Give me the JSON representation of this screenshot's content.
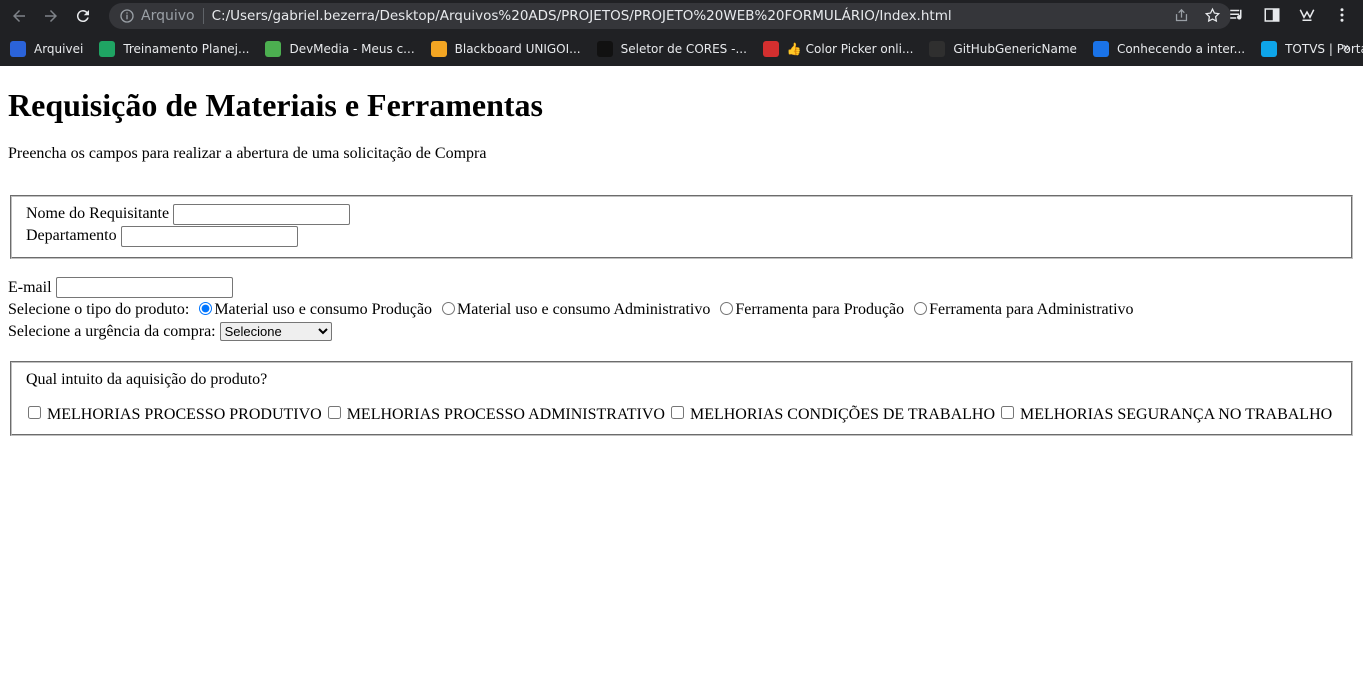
{
  "browser": {
    "address_label": "Arquivo",
    "url": "C:/Users/gabriel.bezerra/Desktop/Arquivos%20ADS/PROJETOS/PROJETO%20WEB%20FORMULÁRIO/Index.html",
    "bookmarks": [
      {
        "label": "Arquivei",
        "icon": "arquivei-icon",
        "color": "#2b63d9"
      },
      {
        "label": "Treinamento Planej...",
        "icon": "google-drive-icon",
        "color": "#1fa463"
      },
      {
        "label": "DevMedia - Meus c...",
        "icon": "devmedia-icon",
        "color": "#4caf50"
      },
      {
        "label": "Blackboard UNIGOI...",
        "icon": "blackboard-icon",
        "color": "#f4a623"
      },
      {
        "label": "Seletor de CORES -...",
        "icon": "m-logo-icon",
        "color": "#111111"
      },
      {
        "label": "👍 Color Picker onli...",
        "icon": "color-picker-icon",
        "color": "#d32f2f"
      },
      {
        "label": "GitHubGenericName",
        "icon": "github-icon",
        "color": "#2f2f2f"
      },
      {
        "label": "Conhecendo a inter...",
        "icon": "page-icon",
        "color": "#1a73e8"
      },
      {
        "label": "TOTVS | Portal - UN...",
        "icon": "totvs-icon",
        "color": "#0ea5e9"
      }
    ],
    "more_label": "»"
  },
  "page": {
    "title": "Requisição de Materiais e Ferramentas",
    "intro": "Preencha os campos para realizar a abertura de uma solicitação de Compra",
    "requester_label": "Nome do Requisitante",
    "requester_value": "",
    "department_label": "Departamento",
    "department_value": "",
    "email_label": "E-mail",
    "email_value": "",
    "product_type_label": "Selecione o tipo do produto:",
    "product_types": [
      {
        "label": "Material uso e consumo Produção",
        "checked": true
      },
      {
        "label": "Material uso e consumo Administrativo",
        "checked": false
      },
      {
        "label": "Ferramenta para Produção",
        "checked": false
      },
      {
        "label": "Ferramenta para Administrativo",
        "checked": false
      }
    ],
    "urgency_label": "Selecione a urgência da compra:",
    "urgency_selected": "Selecione",
    "purpose_question": "Qual intuito da aquisição do produto?",
    "purposes": [
      {
        "label": "MELHORIAS PROCESSO PRODUTIVO",
        "checked": false
      },
      {
        "label": "MELHORIAS PROCESSO ADMINISTRATIVO",
        "checked": false
      },
      {
        "label": "MELHORIAS CONDIÇÕES DE TRABALHO",
        "checked": false
      },
      {
        "label": "MELHORIAS SEGURANÇA NO TRABALHO",
        "checked": false
      }
    ]
  }
}
